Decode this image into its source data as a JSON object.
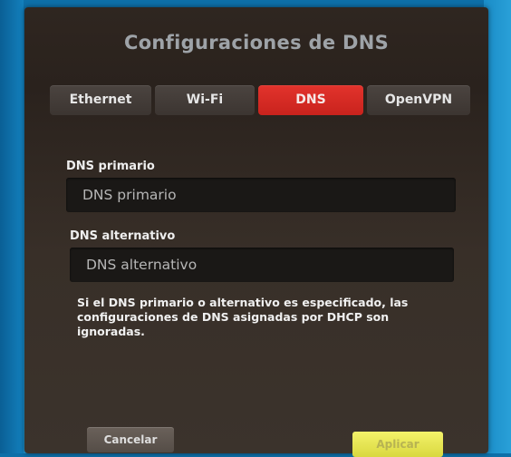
{
  "dialog": {
    "title": "Configuraciones de DNS"
  },
  "tabs": [
    {
      "label": "Ethernet",
      "selected": false
    },
    {
      "label": "Wi-Fi",
      "selected": false
    },
    {
      "label": "DNS",
      "selected": true
    },
    {
      "label": "OpenVPN",
      "selected": false
    }
  ],
  "fields": {
    "primary": {
      "label": "DNS primario",
      "placeholder": "DNS primario",
      "value": ""
    },
    "alternate": {
      "label": "DNS alternativo",
      "placeholder": "DNS alternativo",
      "value": ""
    }
  },
  "note": "Si el DNS primario o alternativo es especificado, las configuraciones de DNS asignadas por DHCP son ignoradas.",
  "buttons": {
    "cancel": "Cancelar",
    "apply": "Aplicar"
  },
  "colors": {
    "selected_tab": "#d62a24",
    "apply_button": "#e8e756",
    "dialog_background": "#2f2620",
    "desktop_background": "#1787c2"
  }
}
